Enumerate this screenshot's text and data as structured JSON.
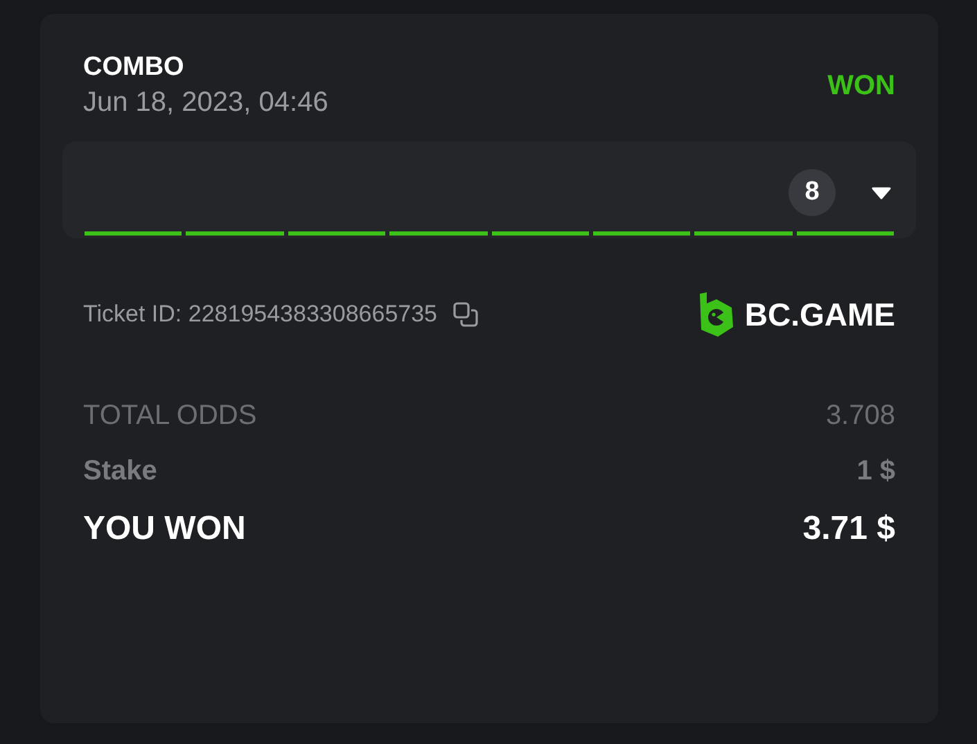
{
  "bet": {
    "type": "COMBO",
    "date": "Jun 18, 2023, 04:46",
    "status": {
      "label": "WON",
      "kind": "won"
    }
  },
  "selections": {
    "count": "8",
    "expanded": false,
    "legs": [
      {
        "won": true
      },
      {
        "won": true
      },
      {
        "won": true
      },
      {
        "won": true
      },
      {
        "won": true
      },
      {
        "won": true
      },
      {
        "won": true
      },
      {
        "won": true
      }
    ]
  },
  "ticket": {
    "label": "Ticket ID: 2281954383308665735"
  },
  "brand": {
    "name": "BC.GAME"
  },
  "summary": [
    {
      "label": "TOTAL ODDS",
      "value": "3.708",
      "kind": "muted"
    },
    {
      "label": "Stake",
      "value": "1 $",
      "kind": "medium"
    },
    {
      "label": "YOU WON",
      "value": "3.71 $",
      "kind": "total"
    }
  ]
}
